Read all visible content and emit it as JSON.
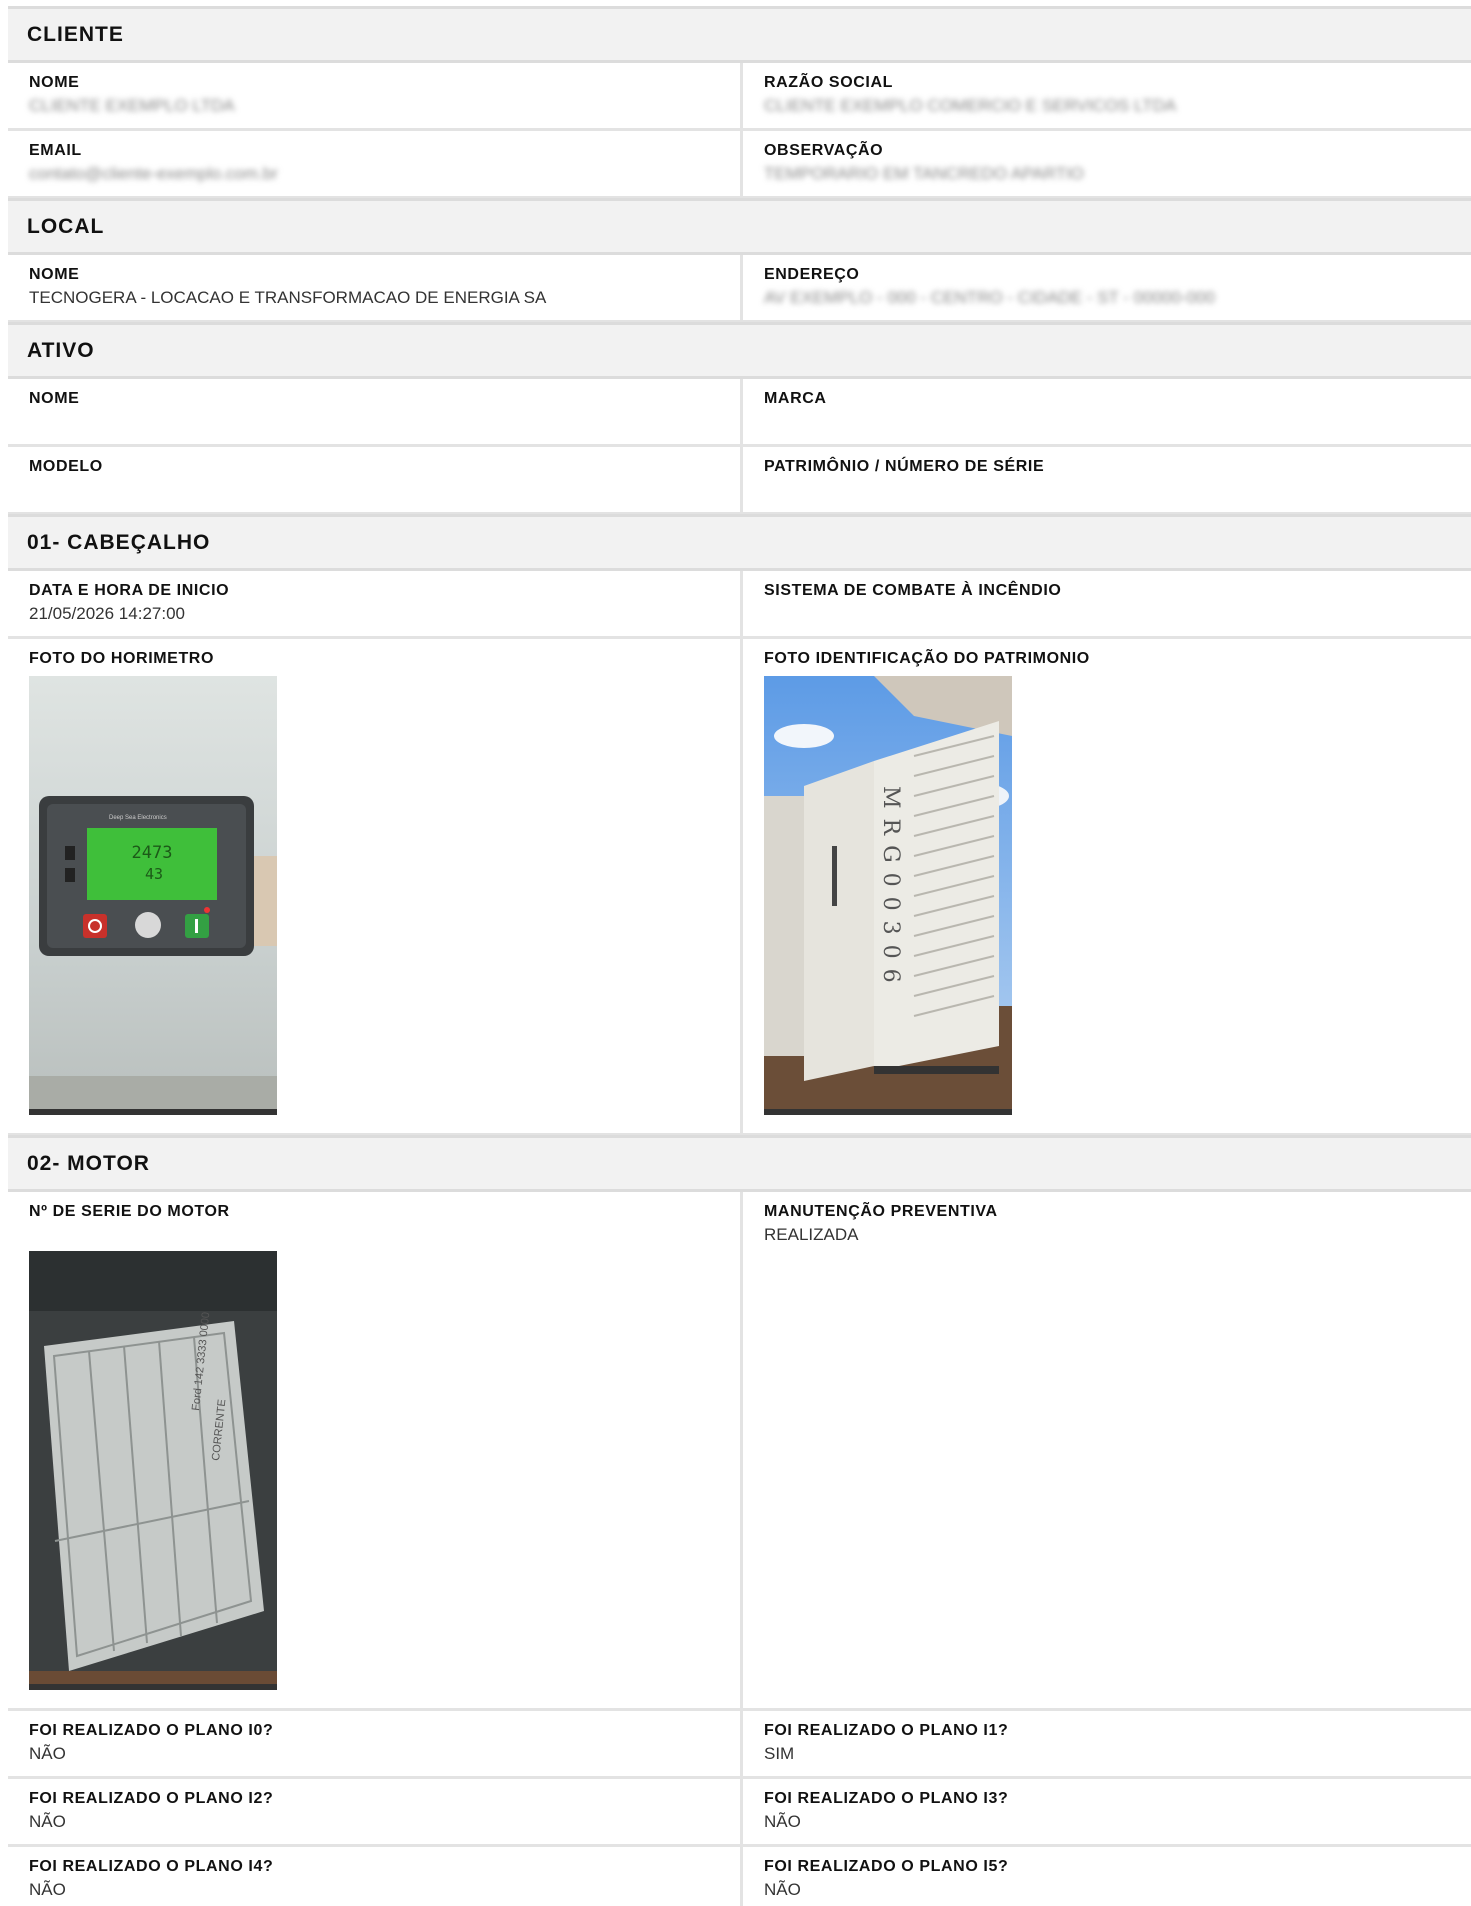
{
  "cliente": {
    "title": "CLIENTE",
    "nome_label": "NOME",
    "nome_value": "CLIENTE EXEMPLO LTDA",
    "razao_label": "RAZÃO SOCIAL",
    "razao_value": "CLIENTE EXEMPLO COMERCIO E SERVICOS LTDA",
    "email_label": "EMAIL",
    "email_value": "contato@cliente-exemplo.com.br",
    "obs_label": "OBSERVAÇÃO",
    "obs_value": "TEMPORARIO EM TANCREDO APARTIO"
  },
  "local": {
    "title": "LOCAL",
    "nome_label": "NOME",
    "nome_value": "TECNOGERA - LOCACAO E TRANSFORMACAO DE ENERGIA SA",
    "endereco_label": "ENDEREÇO",
    "endereco_value": "AV EXEMPLO - 000 - CENTRO - CIDADE - ST - 00000-000"
  },
  "ativo": {
    "title": "ATIVO",
    "nome_label": "NOME",
    "marca_label": "MARCA",
    "modelo_label": "MODELO",
    "patrimonio_label": "PATRIMÔNIO / NÚMERO DE SÉRIE"
  },
  "cabecalho": {
    "title": "01- CABEÇALHO",
    "data_label": "DATA E HORA DE INICIO",
    "data_value": "21/05/2026 14:27:00",
    "sistema_label": "SISTEMA DE COMBATE À INCÊNDIO",
    "foto_horimetro_label": "FOTO DO HORIMETRO",
    "foto_patrimonio_label": "FOTO IDENTIFICAÇÃO DO PATRIMONIO",
    "horimetro_display": "2473",
    "horimetro_sub": "43",
    "panel_brand": "Deep Sea Electronics",
    "generator_tag": "MRG00306"
  },
  "motor": {
    "title": "02- MOTOR",
    "serie_label": "Nº DE SERIE DO MOTOR",
    "manutencao_label": "MANUTENÇÃO PREVENTIVA",
    "manutencao_value": "REALIZADA",
    "plate_text": "Ford 142 3333 0000",
    "plate_corrente": "CORRENTE",
    "i0_label": "FOI REALIZADO O PLANO I0?",
    "i0_value": "NÃO",
    "i1_label": "FOI REALIZADO O PLANO I1?",
    "i1_value": "SIM",
    "i2_label": "FOI REALIZADO O PLANO I2?",
    "i2_value": "NÃO",
    "i3_label": "FOI REALIZADO O PLANO I3?",
    "i3_value": "NÃO",
    "i4_label": "FOI REALIZADO O PLANO I4?",
    "i4_value": "NÃO",
    "i5_label": "FOI REALIZADO O PLANO I5?",
    "i5_value": "NÃO"
  }
}
